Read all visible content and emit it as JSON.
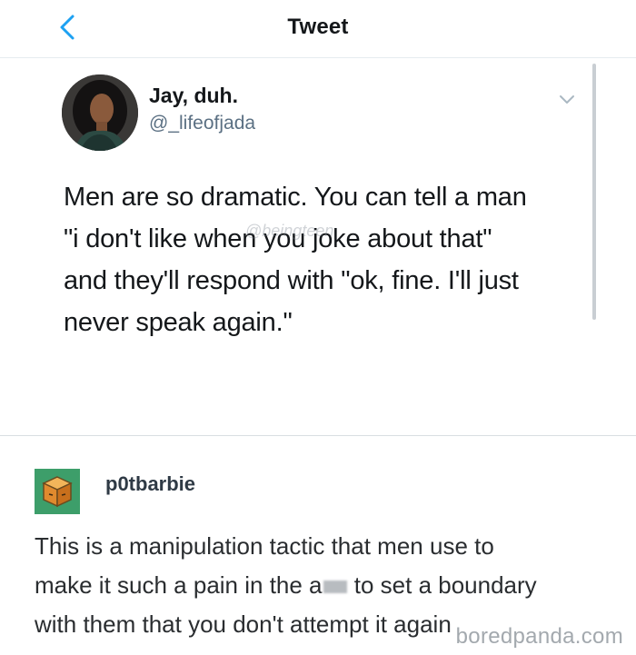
{
  "header": {
    "title": "Tweet",
    "back_icon": "chevron-left-icon",
    "accent_color": "#1da1f2"
  },
  "tweet": {
    "display_name": "Jay, duh.",
    "handle": "@_lifeofjada",
    "menu_icon": "chevron-down-icon",
    "text_lines": [
      "Men are so dramatic. You can tell a man",
      "\"i don't like when you joke about that\"",
      "and they'll respond with \"ok, fine. I'll just",
      "never speak again.\""
    ],
    "overlay_watermark": "@beingteen"
  },
  "reply": {
    "username": "p0tbarbie",
    "avatar_icon": "cube-icon",
    "avatar_color": "#3d9e6a",
    "text_line1": "This is a manipulation tactic that men use to",
    "text_line2_before": "make it such a pain in the a",
    "text_line2_after": " to set a boundary",
    "text_line3": "with them that you don't attempt it again"
  },
  "watermark": "boredpanda.com"
}
